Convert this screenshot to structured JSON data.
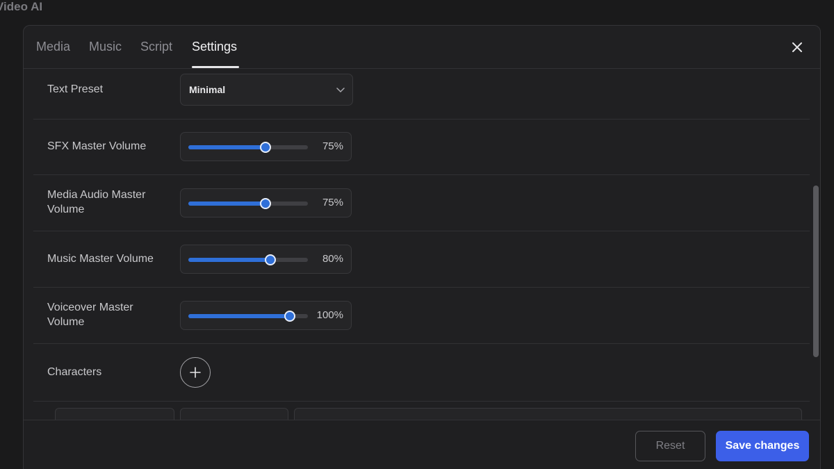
{
  "app": {
    "title": "Video AI"
  },
  "tabs": [
    {
      "label": "Media",
      "active": false
    },
    {
      "label": "Music",
      "active": false
    },
    {
      "label": "Script",
      "active": false
    },
    {
      "label": "Settings",
      "active": true
    }
  ],
  "close": {
    "icon": "close-icon"
  },
  "settings": {
    "text_preset": {
      "label": "Text Preset",
      "value": "Minimal",
      "icon": "chevron-down-icon"
    },
    "sfx_volume": {
      "label": "SFX Master Volume",
      "value_text": "75%",
      "value": 75
    },
    "media_audio_volume": {
      "label": "Media Audio Master Volume",
      "value_text": "75%",
      "value": 75
    },
    "music_volume": {
      "label": "Music Master Volume",
      "value_text": "80%",
      "value": 80
    },
    "voiceover_volume": {
      "label": "Voiceover Master Volume",
      "value_text": "100%",
      "value": 100
    },
    "characters": {
      "label": "Characters",
      "icon": "plus-icon"
    }
  },
  "footer": {
    "reset_label": "Reset",
    "save_label": "Save changes"
  },
  "colors": {
    "accent": "#2f6fd8",
    "primary_button": "#3c5fe8",
    "background": "#202022"
  }
}
